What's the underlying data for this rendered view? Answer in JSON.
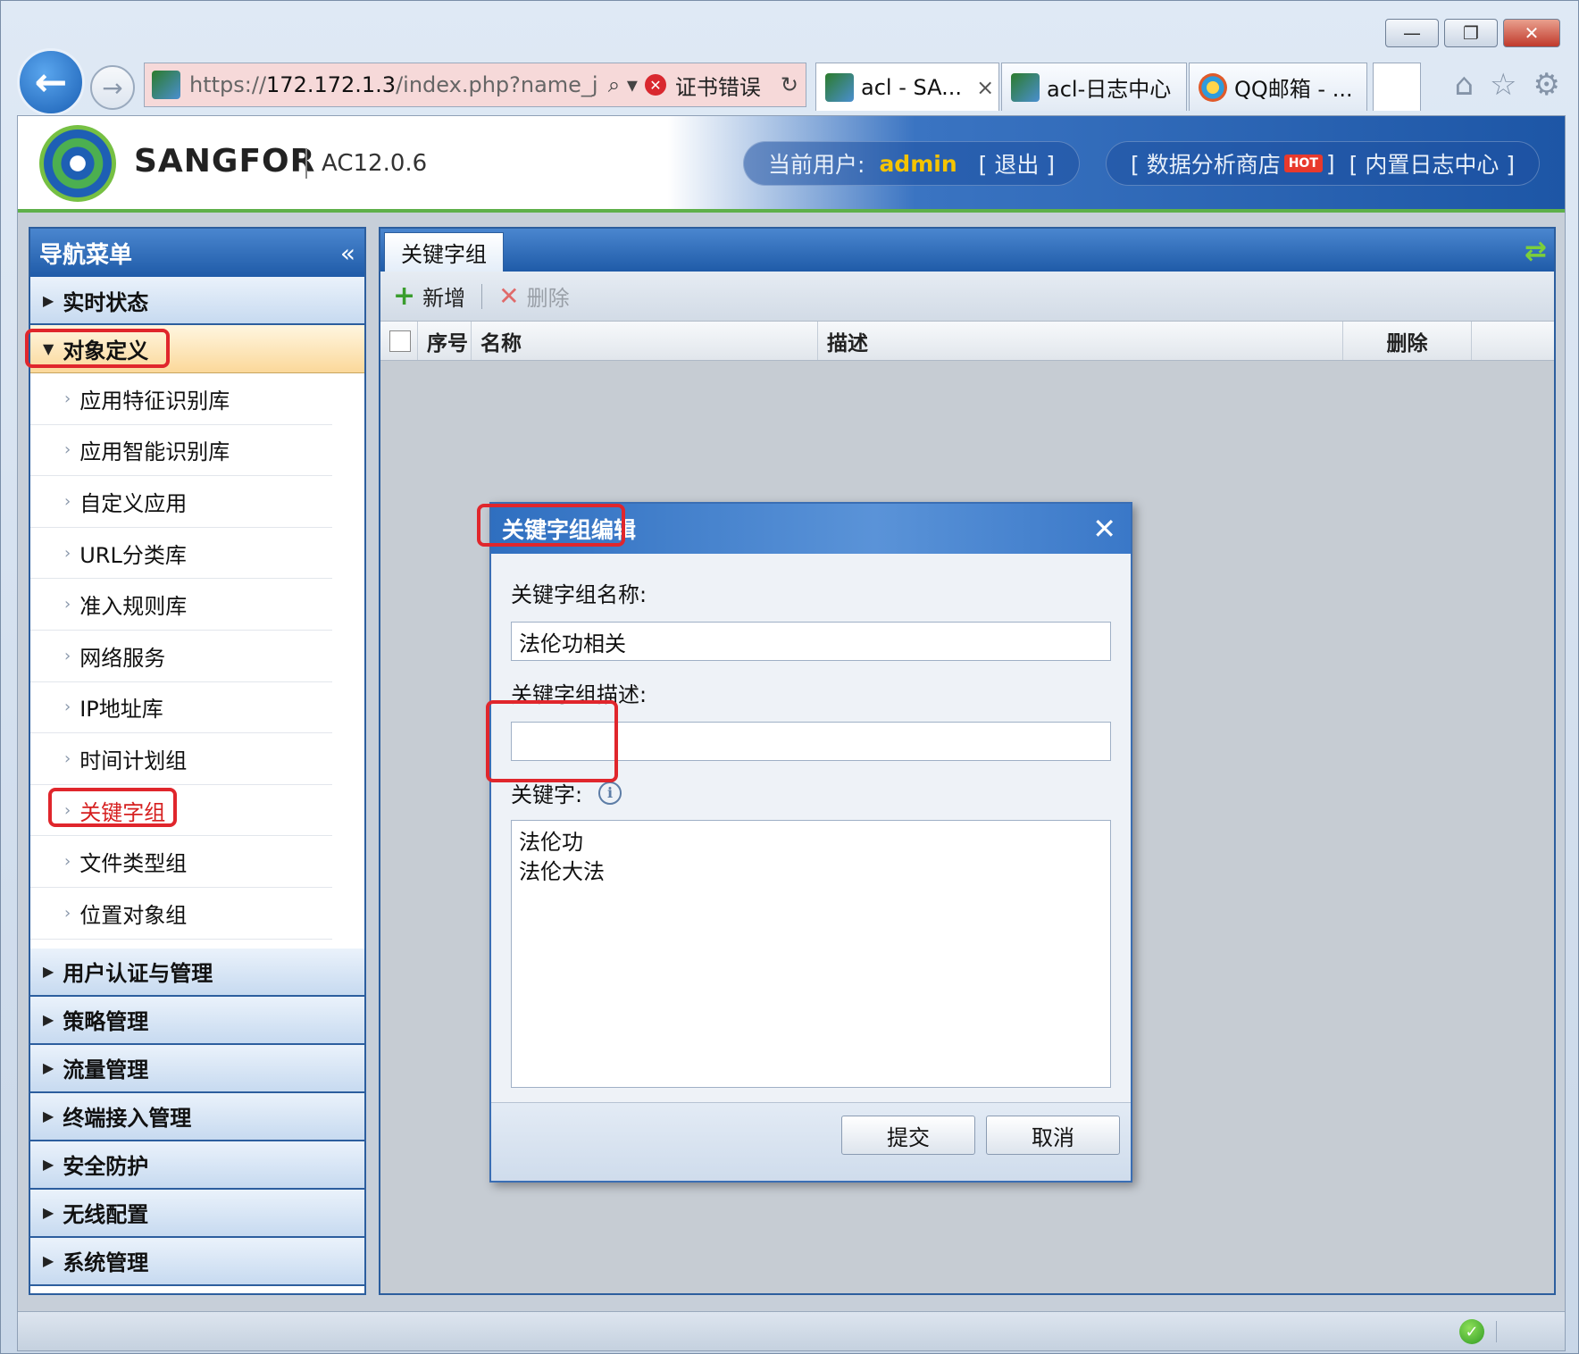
{
  "browser": {
    "url_prefix": "https://",
    "url_host": "172.172.1.3",
    "url_rest": "/index.php?name_j",
    "search_glyph": "⌕ ▾",
    "cert_error": "证书错误",
    "reload_glyph": "↻",
    "tabs": [
      {
        "label": "acl - SA...",
        "close": "×",
        "icon": "sangfor-favicon"
      },
      {
        "label": "acl-日志中心",
        "icon": "sangfor-favicon"
      },
      {
        "label": "QQ邮箱 - ...",
        "icon": "qq-mail-favicon"
      }
    ],
    "window_buttons": {
      "minimize": "—",
      "maximize": "❐",
      "close": "✕"
    },
    "toolbar_icons": {
      "home": "⌂",
      "favorites": "☆",
      "settings": "⚙"
    }
  },
  "header": {
    "brand": "SANGFOR",
    "version": "AC12.0.6",
    "current_user_label": "当前用户:",
    "username": "admin",
    "logout": "[ 退出 ]",
    "data_store_open": "[ 数据分析商店",
    "hot_badge": "HOT",
    "data_store_close": "]",
    "log_center": "[ 内置日志中心 ]"
  },
  "sidebar": {
    "title": "导航菜单",
    "collapse_glyph": "«",
    "groups_top": [
      {
        "label": "实时状态",
        "open": false
      }
    ],
    "open_group": {
      "label": "对象定义"
    },
    "sub_items": [
      {
        "label": "应用特征识别库"
      },
      {
        "label": "应用智能识别库"
      },
      {
        "label": "自定义应用"
      },
      {
        "label": "URL分类库"
      },
      {
        "label": "准入规则库"
      },
      {
        "label": "网络服务"
      },
      {
        "label": "IP地址库"
      },
      {
        "label": "时间计划组"
      },
      {
        "label": "关键字组",
        "selected": true
      },
      {
        "label": "文件类型组"
      },
      {
        "label": "位置对象组"
      }
    ],
    "groups_bottom": [
      {
        "label": "用户认证与管理"
      },
      {
        "label": "策略管理"
      },
      {
        "label": "流量管理"
      },
      {
        "label": "终端接入管理"
      },
      {
        "label": "安全防护"
      },
      {
        "label": "无线配置"
      },
      {
        "label": "系统管理"
      }
    ]
  },
  "main": {
    "tab": "关键字组",
    "toolbar": {
      "add": "新增",
      "delete": "删除"
    },
    "columns": {
      "index": "序号",
      "name": "名称",
      "description": "描述",
      "delete": "删除"
    }
  },
  "dialog": {
    "title": "关键字组编辑",
    "close_glyph": "✕",
    "name_label": "关键字组名称:",
    "name_value": "法伦功相关",
    "desc_label": "关键字组描述:",
    "desc_value": "",
    "keywords_label": "关键字:",
    "keywords_value": "法伦功\n法伦大法",
    "submit": "提交",
    "cancel": "取消"
  },
  "colors": {
    "accent_blue": "#1f5ba8",
    "highlight_red": "#e0262c",
    "username_yellow": "#f5c400",
    "selected_item_red": "#d62020"
  }
}
